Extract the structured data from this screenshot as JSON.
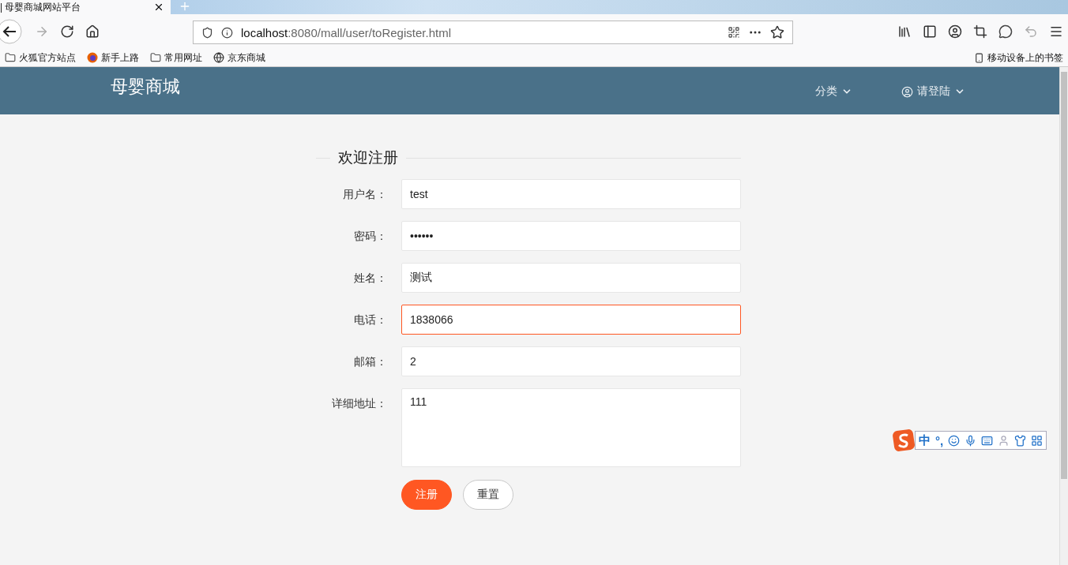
{
  "browser": {
    "tab_title": "| 母婴商城网站平台",
    "url_host": "localhost",
    "url_rest": ":8080/mall/user/toRegister.html",
    "bookmarks": [
      {
        "kind": "folder",
        "label": "火狐官方站点"
      },
      {
        "kind": "browser",
        "label": "新手上路"
      },
      {
        "kind": "folder",
        "label": "常用网址"
      },
      {
        "kind": "globe",
        "label": "京东商城"
      }
    ],
    "mobile_bookmarks": "移动设备上的书签"
  },
  "navbar": {
    "brand": "母婴商城",
    "menus": [
      {
        "kind": "plain",
        "label": "分类"
      },
      {
        "kind": "user",
        "label": "请登陆"
      }
    ]
  },
  "form": {
    "title": "欢迎注册",
    "fields": [
      {
        "kind": "input",
        "label": "用户名：",
        "value": "test",
        "focused": false
      },
      {
        "kind": "input",
        "label": "密码：",
        "value": "••••••",
        "focused": false
      },
      {
        "kind": "input",
        "label": "姓名：",
        "value": "测试",
        "focused": false
      },
      {
        "kind": "input",
        "label": "电话：",
        "value": "1838066",
        "focused": true
      },
      {
        "kind": "input",
        "label": "邮箱：",
        "value": "2",
        "focused": false
      },
      {
        "kind": "textarea",
        "label": "详细地址：",
        "value": "111",
        "focused": false
      }
    ],
    "buttons": [
      {
        "kind": "primary",
        "label": "注册"
      },
      {
        "kind": "plain",
        "label": "重置"
      }
    ]
  },
  "ime_toolbar": {
    "mode": "中",
    "punctuation": "°,"
  }
}
